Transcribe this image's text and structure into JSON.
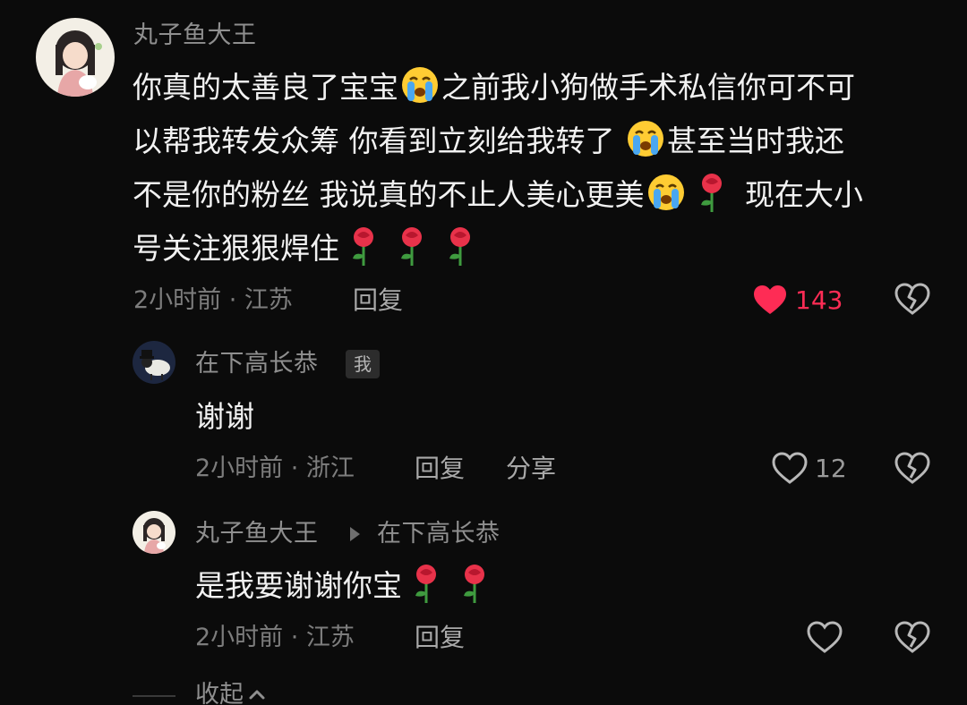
{
  "comments": [
    {
      "user": "丸子鱼大王",
      "lines": [
        [
          "你真的太善良了宝宝",
          "cry-emoji",
          "之前我小狗做手术私信你可不可"
        ],
        [
          "以帮我转发众筹 你看到立刻给我转了 ",
          "cry-emoji",
          "甚至当时我还"
        ],
        [
          "不是你的粉丝 我说真的不止人美心更美",
          "cry-emoji",
          "rose-emoji",
          " 现在大小"
        ],
        [
          "号关注狠狠焊住",
          "rose-emoji",
          "rose-emoji",
          "rose-emoji"
        ]
      ],
      "meta": "2小时前 · 江苏",
      "reply_label": "回复",
      "like_count": "143",
      "liked": true
    },
    {
      "user": "在下高长恭",
      "badge": "我",
      "text": "谢谢",
      "meta": "2小时前 · 浙江",
      "reply_label": "回复",
      "share_label": "分享",
      "like_count": "12",
      "liked": false
    },
    {
      "user": "丸子鱼大王",
      "reply_to": "在下高长恭",
      "text": "是我要谢谢你宝",
      "text_icons": [
        "rose-emoji",
        "rose-emoji"
      ],
      "meta": "2小时前 · 江苏",
      "reply_label": "回复",
      "liked": false
    }
  ],
  "collapse_label": "收起",
  "colors": {
    "background": "#0b0b0b",
    "like_red": "#fe2c55",
    "text_primary": "#f2f2f2",
    "text_secondary": "#8f8f8f"
  }
}
